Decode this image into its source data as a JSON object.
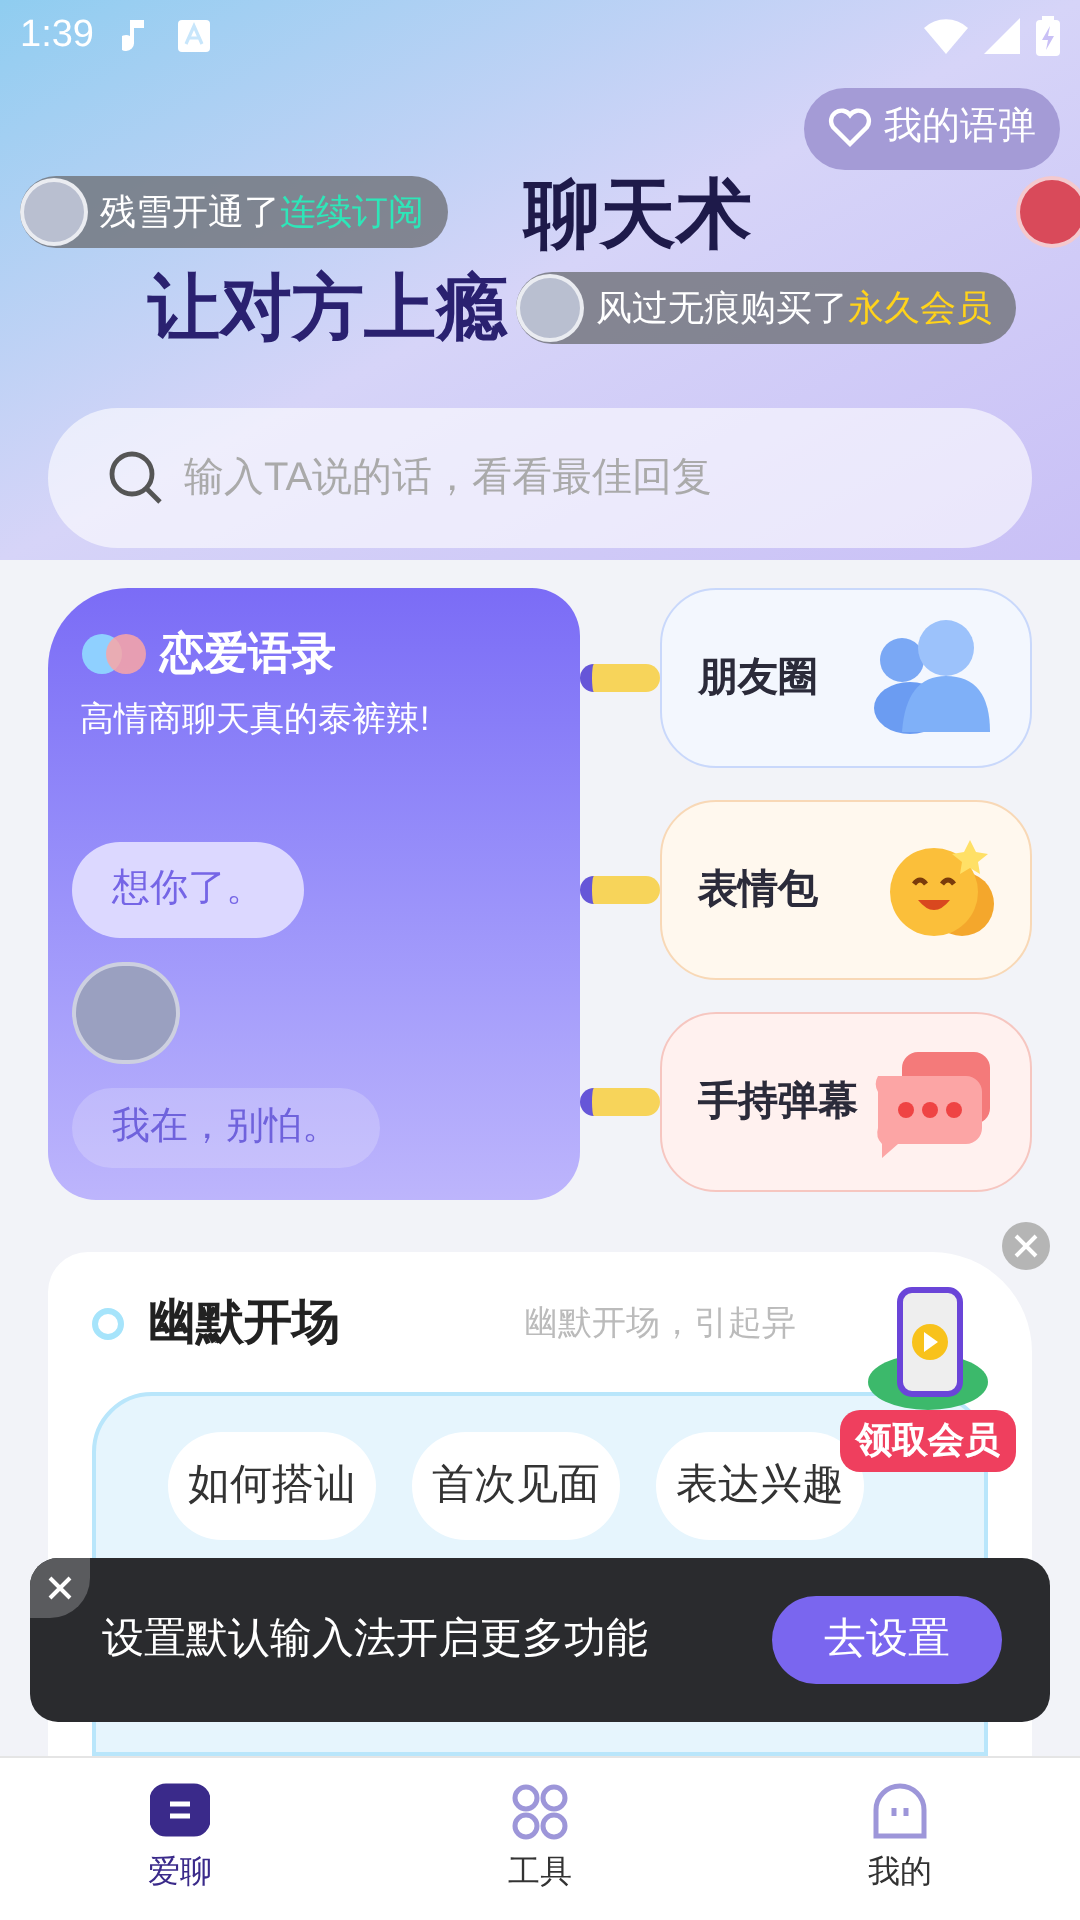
{
  "status_bar": {
    "time": "1:39"
  },
  "header": {
    "title_line_1": "聊天术",
    "title_line_2": "让对方上瘾",
    "my_quotes_button": "我的语弹"
  },
  "barrage": [
    {
      "user": "残雪开通了",
      "product": "连续订阅",
      "color": "#2ee6b8"
    },
    {
      "user": "风过无痕购买了",
      "product": "永久会员",
      "color": "#ffd31a"
    }
  ],
  "search": {
    "placeholder": "输入TA说的话，看看最佳回复"
  },
  "quotes_card": {
    "title": "恋爱语录",
    "subtitle": "高情商聊天真的泰裤辣!",
    "messages": [
      "想你了。",
      "我在，别怕。"
    ]
  },
  "features": [
    {
      "label": "朋友圈",
      "kind": "people"
    },
    {
      "label": "表情包",
      "kind": "emoji"
    },
    {
      "label": "手持弹幕",
      "kind": "chat"
    }
  ],
  "section": {
    "title": "幽默开场",
    "subtitle": "幽默开场，引起异",
    "chips": [
      "如何搭讪",
      "首次见面",
      "表达兴趣"
    ]
  },
  "promo": {
    "label": "领取会员"
  },
  "toast": {
    "message": "设置默认输入法开启更多功能",
    "action": "去设置"
  },
  "tabs": [
    {
      "label": "爱聊",
      "selected": true,
      "kind": "chat"
    },
    {
      "label": "工具",
      "selected": false,
      "kind": "tools"
    },
    {
      "label": "我的",
      "selected": false,
      "kind": "me"
    }
  ]
}
